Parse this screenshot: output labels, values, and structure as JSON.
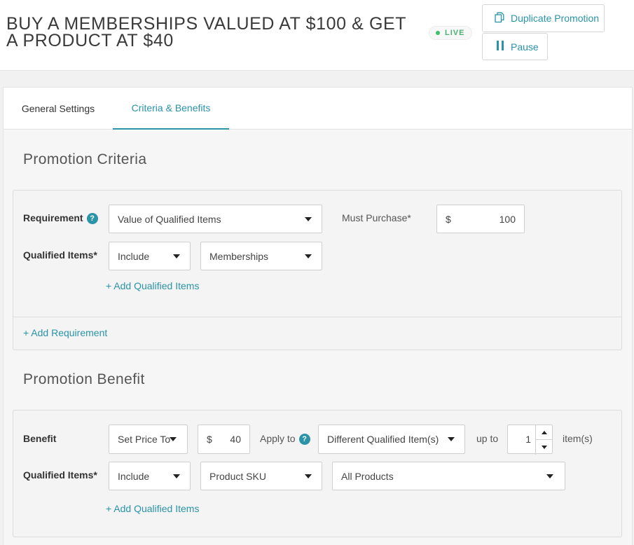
{
  "header": {
    "title": "BUY A MEMBERSHIPS VALUED AT $100 & GET A PRODUCT AT $40",
    "status_badge": "LIVE",
    "duplicate_button": "Duplicate Promotion",
    "pause_button": "Pause"
  },
  "tabs": [
    {
      "label": "General Settings",
      "active": false
    },
    {
      "label": "Criteria & Benefits",
      "active": true
    }
  ],
  "criteria": {
    "section_title": "Promotion Criteria",
    "requirement_label": "Requirement",
    "requirement_select": "Value of Qualified Items",
    "must_purchase_label": "Must Purchase*",
    "must_purchase_currency": "$",
    "must_purchase_value": "100",
    "qualified_items_label": "Qualified Items*",
    "qualified_items_mode": "Include",
    "qualified_items_type": "Memberships",
    "add_qualified_items": "+ Add Qualified Items",
    "add_requirement": "+ Add Requirement"
  },
  "benefit": {
    "section_title": "Promotion Benefit",
    "benefit_label": "Benefit",
    "benefit_select": "Set Price To",
    "price_currency": "$",
    "price_value": "40",
    "apply_to_label": "Apply to",
    "apply_to_select": "Different Qualified Item(s)",
    "up_to_label": "up to",
    "quantity_value": "1",
    "items_suffix": "item(s)",
    "qualified_items_label": "Qualified Items*",
    "qualified_items_mode": "Include",
    "qualified_items_type": "Product SKU",
    "qualified_items_scope": "All Products",
    "add_qualified_items": "+ Add Qualified Items"
  },
  "colors": {
    "accent": "#2a93a8",
    "live_green": "#3fbf6b"
  }
}
